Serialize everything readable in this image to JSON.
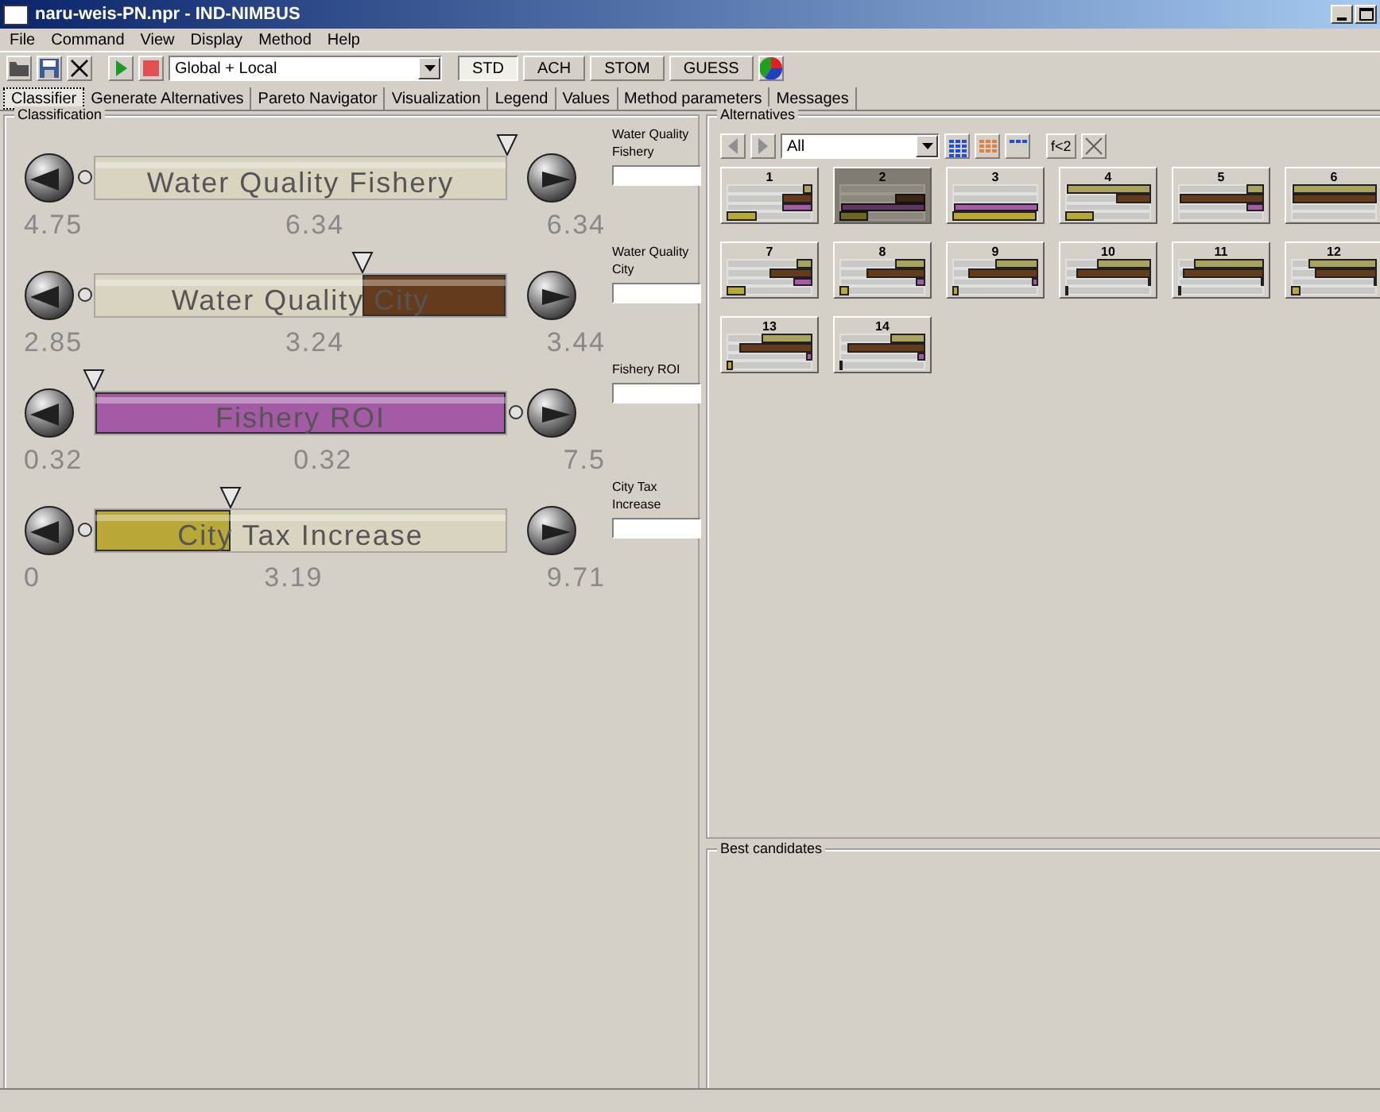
{
  "window": {
    "title": "naru-weis-PN.npr - IND-NIMBUS"
  },
  "menu": [
    "File",
    "Command",
    "View",
    "Display",
    "Method",
    "Help"
  ],
  "toolbar": {
    "method_dropdown": "Global + Local",
    "methods": [
      {
        "label": "STD",
        "selected": true
      },
      {
        "label": "ACH",
        "selected": false
      },
      {
        "label": "STOM",
        "selected": false
      },
      {
        "label": "GUESS",
        "selected": false
      }
    ]
  },
  "tabs": [
    {
      "label": "Classifier",
      "selected": true
    },
    {
      "label": "Generate Alternatives",
      "selected": false
    },
    {
      "label": "Pareto Navigator",
      "selected": false
    },
    {
      "label": "Visualization",
      "selected": false
    },
    {
      "label": "Legend",
      "selected": false
    },
    {
      "label": "Values",
      "selected": false
    },
    {
      "label": "Method parameters",
      "selected": false
    },
    {
      "label": "Messages",
      "selected": false
    }
  ],
  "classification": {
    "title": "Classification",
    "objectives": [
      {
        "name": "Water Quality Fishery",
        "field_label": "Water Quality Fishery",
        "min": "4.75",
        "value": "6.34",
        "max": "6.34",
        "level": 1.0,
        "fill_from_max": true
      },
      {
        "name": "Water Quality City",
        "field_label": "Water Quality City",
        "min": "2.85",
        "value": "3.24",
        "max": "3.44",
        "level": 0.65,
        "fill_from_max": true
      },
      {
        "name": "Fishery ROI",
        "field_label": "Fishery ROI",
        "min": "0.32",
        "value": "0.32",
        "max": "7.5",
        "level": 0.0,
        "fill_from_max": true
      },
      {
        "name": "City Tax Increase",
        "field_label": "City Tax Increase",
        "min": "0",
        "value": "3.19",
        "max": "9.71",
        "level": 0.33,
        "fill_from_max": false
      }
    ]
  },
  "alternatives": {
    "title": "Alternatives",
    "filter": "All",
    "formula_button": "f<2",
    "items": [
      {
        "label": "1",
        "selected": false,
        "bars": [
          {
            "kind": "fishery",
            "level": 0.1
          },
          {
            "kind": "city",
            "level": 0.35
          },
          {
            "kind": "roi",
            "level": 0.35
          },
          {
            "kind": "tax",
            "level": 0.35
          }
        ]
      },
      {
        "label": "2",
        "selected": true,
        "bars": [
          {
            "kind": "city",
            "level": 0.35
          },
          {
            "kind": "roi",
            "level": 1.0
          },
          {
            "kind": "tax",
            "level": 0.33
          }
        ]
      },
      {
        "label": "3",
        "selected": false,
        "bars": [
          {
            "kind": "roi",
            "level": 1.0
          },
          {
            "kind": "tax",
            "level": 1.0
          }
        ]
      },
      {
        "label": "4",
        "selected": false,
        "bars": [
          {
            "kind": "fishery",
            "level": 1.0
          },
          {
            "kind": "city",
            "level": 0.4
          },
          {
            "kind": "tax",
            "level": 0.33
          }
        ]
      },
      {
        "label": "5",
        "selected": false,
        "bars": [
          {
            "kind": "fishery",
            "level": 0.2
          },
          {
            "kind": "city",
            "level": 1.0
          },
          {
            "kind": "roi",
            "level": 0.2
          }
        ]
      },
      {
        "label": "6",
        "selected": false,
        "bars": [
          {
            "kind": "fishery",
            "level": 1.0
          },
          {
            "kind": "city",
            "level": 1.0
          }
        ]
      },
      {
        "label": "7",
        "selected": false,
        "bars": [
          {
            "kind": "fishery",
            "level": 0.17
          },
          {
            "kind": "city",
            "level": 0.5
          },
          {
            "kind": "roi",
            "level": 0.22
          },
          {
            "kind": "tax",
            "level": 0.22
          }
        ]
      },
      {
        "label": "8",
        "selected": false,
        "bars": [
          {
            "kind": "fishery",
            "level": 0.35
          },
          {
            "kind": "city",
            "level": 0.7
          },
          {
            "kind": "roi",
            "level": 0.1
          },
          {
            "kind": "tax",
            "level": 0.1
          }
        ]
      },
      {
        "label": "9",
        "selected": false,
        "bars": [
          {
            "kind": "fishery",
            "level": 0.5
          },
          {
            "kind": "city",
            "level": 0.83
          },
          {
            "kind": "roi",
            "level": 0.05
          },
          {
            "kind": "tax",
            "level": 0.05
          }
        ]
      },
      {
        "label": "10",
        "selected": false,
        "bars": [
          {
            "kind": "fishery",
            "level": 0.63
          },
          {
            "kind": "city",
            "level": 0.88
          },
          {
            "kind": "roi",
            "level": 0.02
          },
          {
            "kind": "tax",
            "level": 0.02
          }
        ]
      },
      {
        "label": "11",
        "selected": false,
        "bars": [
          {
            "kind": "fishery",
            "level": 0.83
          },
          {
            "kind": "city",
            "level": 0.97
          },
          {
            "kind": "roi",
            "level": 0.01
          },
          {
            "kind": "tax",
            "level": 0.01
          }
        ]
      },
      {
        "label": "12",
        "selected": false,
        "bars": [
          {
            "kind": "fishery",
            "level": 0.8
          },
          {
            "kind": "city",
            "level": 0.73
          },
          {
            "kind": "roi",
            "level": 0.01
          },
          {
            "kind": "tax",
            "level": 0.1
          }
        ]
      },
      {
        "label": "13",
        "selected": false,
        "bars": [
          {
            "kind": "fishery",
            "level": 0.6
          },
          {
            "kind": "city",
            "level": 0.87
          },
          {
            "kind": "roi",
            "level": 0.05
          },
          {
            "kind": "tax",
            "level": 0.05
          }
        ]
      },
      {
        "label": "14",
        "selected": false,
        "bars": [
          {
            "kind": "fishery",
            "level": 0.4
          },
          {
            "kind": "city",
            "level": 0.93
          },
          {
            "kind": "roi",
            "level": 0.07
          },
          {
            "kind": "tax",
            "level": 0.02
          }
        ]
      }
    ]
  },
  "best_candidates": {
    "title": "Best candidates"
  }
}
